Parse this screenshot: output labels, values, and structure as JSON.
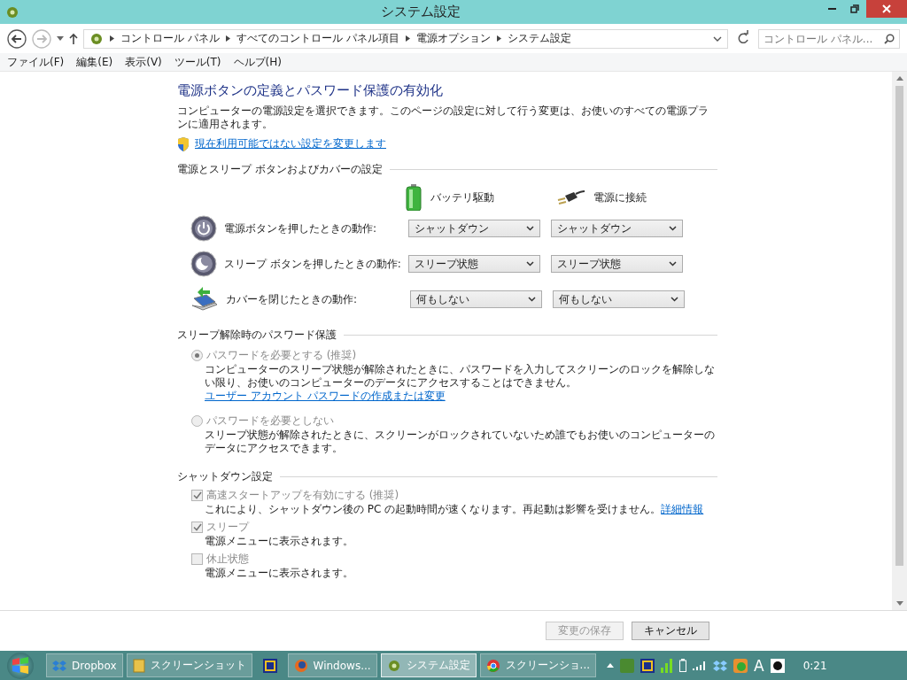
{
  "window": {
    "title": "システム設定"
  },
  "address": {
    "breadcrumb": [
      "コントロール パネル",
      "すべてのコントロール パネル項目",
      "電源オプション",
      "システム設定"
    ],
    "search_placeholder": "コントロール パネル..."
  },
  "menu": [
    "ファイル(F)",
    "編集(E)",
    "表示(V)",
    "ツール(T)",
    "ヘルプ(H)"
  ],
  "page": {
    "heading": "電源ボタンの定義とパスワード保護の有効化",
    "description": "コンピューターの電源設定を選択できます。このページの設定に対して行う変更は、お使いのすべての電源プランに適用されます。",
    "admin_link": "現在利用可能ではない設定を変更します"
  },
  "power_section": {
    "title": "電源とスリープ ボタンおよびカバーの設定",
    "columns": [
      {
        "label": "バッテリ駆動",
        "kind": "battery"
      },
      {
        "label": "電源に接続",
        "kind": "plug"
      }
    ],
    "rows": [
      {
        "kind": "power",
        "label": "電源ボタンを押したときの動作:",
        "values": [
          "シャットダウン",
          "シャットダウン"
        ]
      },
      {
        "kind": "sleep",
        "label": "スリープ ボタンを押したときの動作:",
        "values": [
          "スリープ状態",
          "スリープ状態"
        ]
      },
      {
        "kind": "lid",
        "label": "カバーを閉じたときの動作:",
        "values": [
          "何もしない",
          "何もしない"
        ]
      }
    ]
  },
  "password_section": {
    "title": "スリープ解除時のパスワード保護",
    "options": [
      {
        "label": "パスワードを必要とする (推奨)",
        "selected": true,
        "disabled": true,
        "description": "コンピューターのスリープ状態が解除されたときに、パスワードを入力してスクリーンのロックを解除しない限り、お使いのコンピューターのデータにアクセスすることはできません。",
        "link": "ユーザー アカウント パスワードの作成または変更"
      },
      {
        "label": "パスワードを必要としない",
        "selected": false,
        "disabled": true,
        "description": "スリープ状態が解除されたときに、スクリーンがロックされていないため誰でもお使いのコンピューターのデータにアクセスできます。"
      }
    ]
  },
  "shutdown_section": {
    "title": "シャットダウン設定",
    "options": [
      {
        "label": "高速スタートアップを有効にする (推奨)",
        "checked": true,
        "disabled": true,
        "description": "これにより、シャットダウン後の PC の起動時間が速くなります。再起動は影響を受けません。",
        "link": "詳細情報"
      },
      {
        "label": "スリープ",
        "checked": true,
        "disabled": true,
        "description": "電源メニューに表示されます。"
      },
      {
        "label": "休止状態",
        "checked": false,
        "disabled": true,
        "description": "電源メニューに表示されます。"
      }
    ]
  },
  "buttons": [
    {
      "label": "変更の保存",
      "disabled": true
    },
    {
      "label": "キャンセル",
      "disabled": false
    }
  ],
  "taskbar": {
    "items": [
      {
        "kind": "dropbox",
        "label": "Dropbox",
        "active": false
      },
      {
        "kind": "folder",
        "label": "スクリーンショット",
        "active": false
      },
      {
        "kind": "app",
        "active": false
      },
      {
        "kind": "firefox",
        "label": "Windows...",
        "active": false
      },
      {
        "kind": "settings",
        "label": "システム設定",
        "active": true
      },
      {
        "kind": "chrome",
        "label": "スクリーンショ...",
        "active": false
      }
    ],
    "ime": "A",
    "clock": "0:21"
  }
}
